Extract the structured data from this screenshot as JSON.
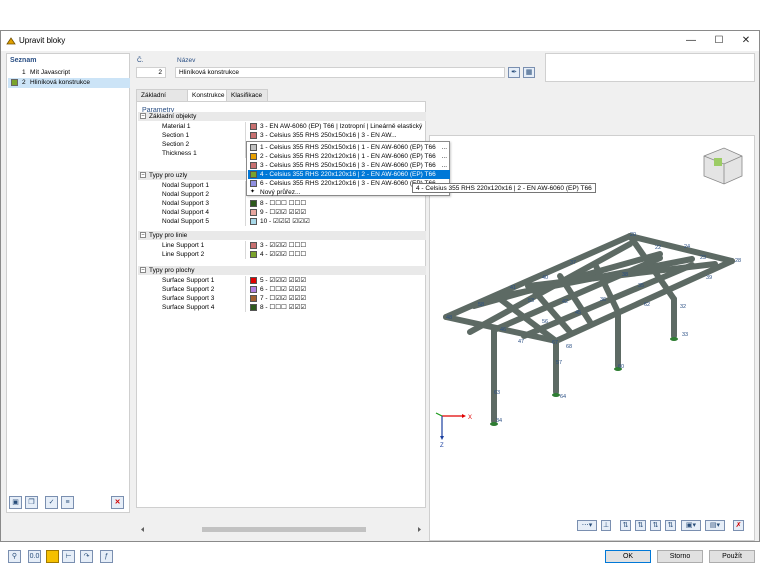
{
  "window": {
    "title": "Upravit bloky"
  },
  "list": {
    "header": "Seznam",
    "items": [
      {
        "num": "1",
        "label": "Mít Javascript",
        "color": ""
      },
      {
        "num": "2",
        "label": "Hliníková konstrukce",
        "color": "#7aa32c"
      }
    ]
  },
  "number": {
    "label": "Č.",
    "value": "2"
  },
  "name": {
    "label": "Název",
    "value": "Hliníková konstrukce"
  },
  "tabs": [
    "Základní údaje",
    "Konstrukce",
    "Klasifikace"
  ],
  "params": {
    "title": "Parametry",
    "groups": [
      {
        "label": "Základní objekty",
        "rows": [
          {
            "name": "Material 1",
            "color": "#c87070",
            "text": "3 - EN AW-6060 (EP) T66 | Izotropní | Lineárně elastický"
          },
          {
            "name": "Section 1",
            "color": "#c87070",
            "text": "3 - Celsius 355 RHS 250x150x16 | 3 - EN AW..."
          },
          {
            "name": "Section 2",
            "color": "",
            "text": ""
          },
          {
            "name": "Thickness 1",
            "color": "",
            "text": ""
          }
        ]
      },
      {
        "label": "Typy pro uzly",
        "rows": [
          {
            "name": "Nodal Support 1",
            "color": "",
            "text": ""
          },
          {
            "name": "Nodal Support 2",
            "color": "",
            "text": ""
          },
          {
            "name": "Nodal Support 3",
            "color": "#2e5a1c",
            "text": "8 - ☐☐☐ ☐☐☐"
          },
          {
            "name": "Nodal Support 4",
            "color": "#e8a7a0",
            "text": "9 - ☐☑☑ ☑☑☑"
          },
          {
            "name": "Nodal Support 5",
            "color": "#a8d8e8",
            "text": "10 - ☑☑☑ ☑☑☑"
          }
        ]
      },
      {
        "label": "Typy pro linie",
        "rows": [
          {
            "name": "Line Support 1",
            "color": "#c87070",
            "text": "3 - ☑☑☑ ☐☐☐"
          },
          {
            "name": "Line Support 2",
            "color": "#7aa32c",
            "text": "4 - ☑☑☑ ☐☐☐"
          }
        ]
      },
      {
        "label": "Typy pro plochy",
        "rows": [
          {
            "name": "Surface Support 1",
            "color": "#e00000",
            "text": "5 - ☑☑☑ ☑☑☑"
          },
          {
            "name": "Surface Support 2",
            "color": "#b080e0",
            "text": "6 - ☐☐☑ ☑☑☑"
          },
          {
            "name": "Surface Support 3",
            "color": "#a06030",
            "text": "7 - ☐☑☑ ☑☑☑"
          },
          {
            "name": "Surface Support 4",
            "color": "#2e5a1c",
            "text": "8 - ☐☐☐ ☑☑☑"
          }
        ]
      }
    ]
  },
  "dropdown": {
    "items": [
      {
        "color": "#c0c0c0",
        "text": "1 - Celsius 355 RHS 250x150x16 | 1 - EN AW-6060 (EP) T66",
        "dots": "..."
      },
      {
        "color": "#e8a000",
        "text": "2 - Celsius 355 RHS 220x120x16 | 1 - EN AW-6060 (EP) T66",
        "dots": "..."
      },
      {
        "color": "#c87070",
        "text": "3 - Celsius 355 RHS 250x150x16 | 3 - EN AW-6060 (EP) T66",
        "dots": "..."
      },
      {
        "color": "#7aa32c",
        "text": "4 - Celsius 355 RHS 220x120x16 | 2 - EN AW-6060 (EP) T66",
        "dots": "",
        "highlighted": true
      },
      {
        "color": "#9090e0",
        "text": "6 - Celsius 355 RHS 220x120x16 | 3 - EN AW-6060 (EP) T66",
        "dots": ""
      },
      {
        "color": "",
        "text": "Nový průřez...",
        "dots": ""
      }
    ],
    "tooltip": "4 - Celsius 355 RHS 220x120x16 | 2 - EN AW-6060 (EP) T66"
  },
  "model": {
    "node_labels": [
      "20",
      "22",
      "24",
      "23",
      "28",
      "40",
      "37",
      "38",
      "39",
      "36",
      "41",
      "33",
      "35",
      "48",
      "58",
      "53",
      "42",
      "45",
      "56",
      "46",
      "47",
      "67",
      "68",
      "60",
      "32",
      "57",
      "63",
      "64",
      "34",
      "62"
    ],
    "axis": {
      "x": "X",
      "z": "Z"
    },
    "colors": {
      "member": "#5d6a64",
      "support": "#2e7d32",
      "label": "#2a4f84"
    }
  },
  "buttons": {
    "ok": "OK",
    "cancel": "Storno",
    "apply": "Použít"
  }
}
